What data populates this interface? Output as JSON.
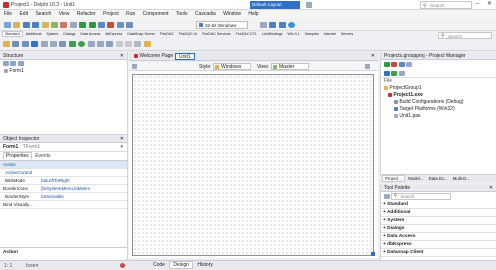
{
  "title_bar": {
    "title": "Project1 - Delphi 10.3 - Unit1",
    "layout_combo": "Default Layout",
    "search_placeholder": "Search"
  },
  "menu": [
    "File",
    "Edit",
    "Search",
    "View",
    "Refactor",
    "Project",
    "Run",
    "Component",
    "Tools",
    "Cascadia",
    "Window",
    "Help"
  ],
  "platform_combo": "32-bit Windows",
  "palette_tabs": [
    "Standard",
    "Additional",
    "System",
    "Dialogs",
    "Data Access",
    "dbExpress",
    "DataSnap Server",
    "FireDAC",
    "FireDAC UI",
    "FireDAC Services",
    "FireDAC ETL",
    "LiveBindings",
    "Win 3.1",
    "Samples",
    "Internet",
    "Servers"
  ],
  "palette_search_placeholder": "Search",
  "editor_tab": "Welcome Page",
  "form_tab": "Unit1",
  "structure": {
    "title": "Structure",
    "root": "Form1"
  },
  "designer_toolbar": {
    "style_label": "Style:",
    "style_value": "Windows",
    "view_label": "View:",
    "view_value": "Master"
  },
  "object_inspector": {
    "title": "Object Inspector",
    "component": "Form1",
    "component_type": "TForm1",
    "tabs": [
      "Properties",
      "Events"
    ],
    "rows": [
      {
        "name": "Action",
        "value": ""
      },
      {
        "name": "ActiveControl",
        "value": ""
      },
      {
        "name": "BiDiMode",
        "value": "bdLeftToRight"
      },
      {
        "name": "BorderIcons",
        "value": "[biSystemMenu,biMinim"
      },
      {
        "name": "BorderStyle",
        "value": "bsSizeable"
      },
      {
        "name": "Bind Visually...",
        "value": ""
      }
    ],
    "footer": "Action"
  },
  "projects": {
    "title": "Projects.groupproj - Project Manager",
    "file_label": "File",
    "items": [
      "ProjectGroup1",
      "Project1.exe",
      "Build Configurations (Debug)",
      "Target Platforms (Win32)",
      "Unit1.pas"
    ]
  },
  "bottom_tabs": [
    "Project...",
    "Model...",
    "Data Ex...",
    "Multi-D..."
  ],
  "tool_palette": {
    "title": "Tool Palette",
    "search_placeholder": "Search",
    "categories": [
      "Standard",
      "Additional",
      "System",
      "Dialogs",
      "Data Access",
      "dbExpress",
      "Datasnap Client",
      "Datasnap Server"
    ]
  },
  "status_tabs": [
    "Code",
    "Design",
    "History"
  ],
  "status_position": "1: 1",
  "status_mode": "Insert",
  "colors": {
    "accent": "#2b6cc4",
    "title_combo_bg": "#2f70c8",
    "workspace": "#f0f0f0"
  }
}
